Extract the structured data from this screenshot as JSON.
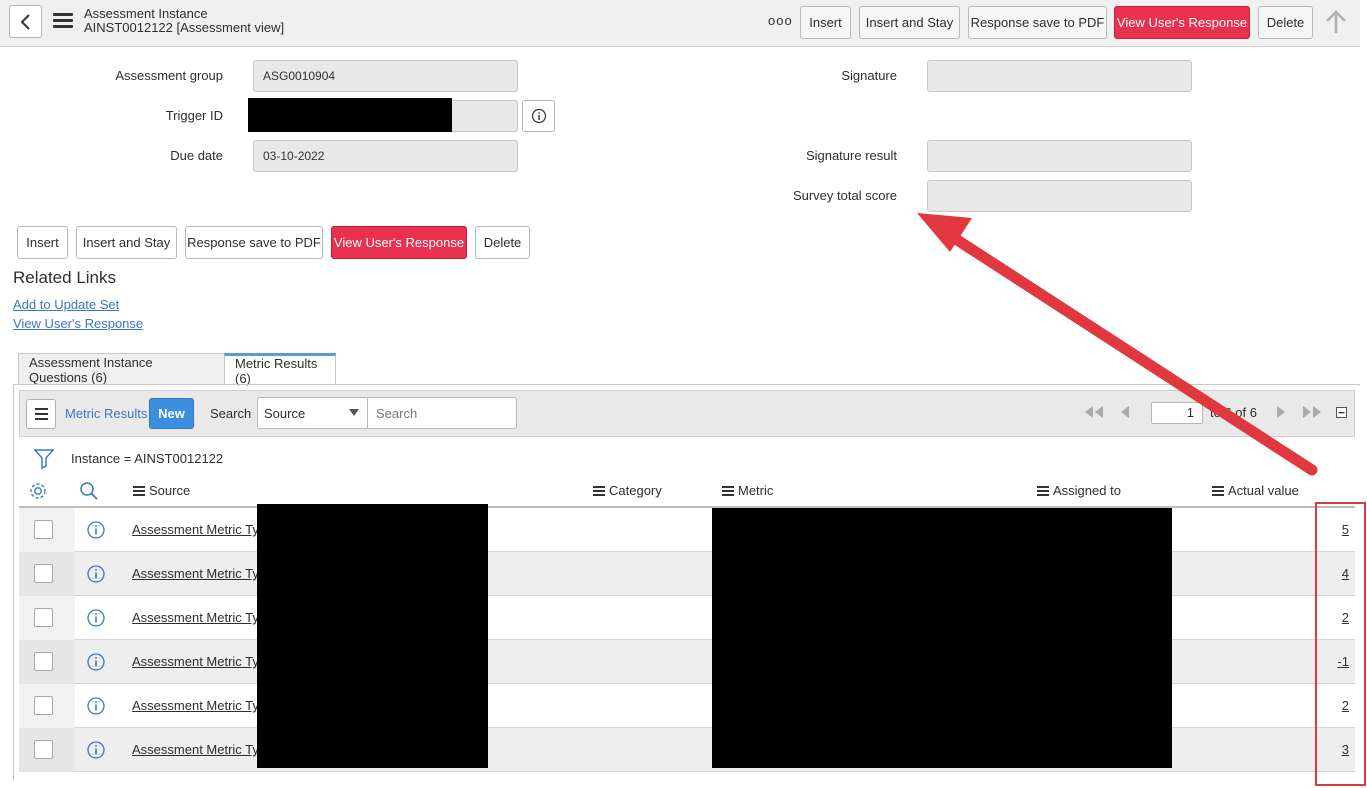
{
  "header": {
    "title": "Assessment Instance",
    "subtitle": "AINST0012122 [Assessment view]",
    "more_label": "ooo",
    "buttons": {
      "insert": "Insert",
      "insert_stay": "Insert and Stay",
      "save_pdf": "Response save to PDF",
      "view_response": "View User's Response",
      "delete": "Delete"
    }
  },
  "form": {
    "assessment_group_label": "Assessment group",
    "assessment_group_value": "ASG0010904",
    "trigger_id_label": "Trigger ID",
    "due_date_label": "Due date",
    "due_date_value": "03-10-2022",
    "signature_label": "Signature",
    "signature_result_label": "Signature result",
    "survey_total_score_label": "Survey total score"
  },
  "bottom_buttons": {
    "insert": "Insert",
    "insert_stay": "Insert and Stay",
    "save_pdf": "Response save to PDF",
    "view_response": "View User's Response",
    "delete": "Delete"
  },
  "related": {
    "title": "Related Links",
    "links": [
      "Add to Update Set",
      "View User's Response"
    ]
  },
  "tabs": [
    {
      "label": "Assessment Instance Questions (6)"
    },
    {
      "label": "Metric Results (6)"
    }
  ],
  "list": {
    "title": "Metric Results",
    "new_label": "New",
    "search_label": "Search",
    "search_field": "Source",
    "search_placeholder": "Search",
    "page_value": "1",
    "page_text": "to 6 of 6",
    "filter_text": "Instance = AINST0012122",
    "columns": [
      "Source",
      "Category",
      "Metric",
      "Assigned to",
      "Actual value"
    ],
    "rows": [
      {
        "source": "Assessment Metric Type",
        "value": "5"
      },
      {
        "source": "Assessment Metric Type",
        "value": "4"
      },
      {
        "source": "Assessment Metric Type",
        "value": "2"
      },
      {
        "source": "Assessment Metric Type",
        "value": "-1"
      },
      {
        "source": "Assessment Metric Type",
        "value": "2"
      },
      {
        "source": "Assessment Metric Type",
        "value": "3"
      }
    ]
  },
  "colors": {
    "accent_red": "#e8304f",
    "link_blue": "#3b77c7",
    "new_blue": "#3c8ee0",
    "annotation_red": "#e0383e"
  }
}
